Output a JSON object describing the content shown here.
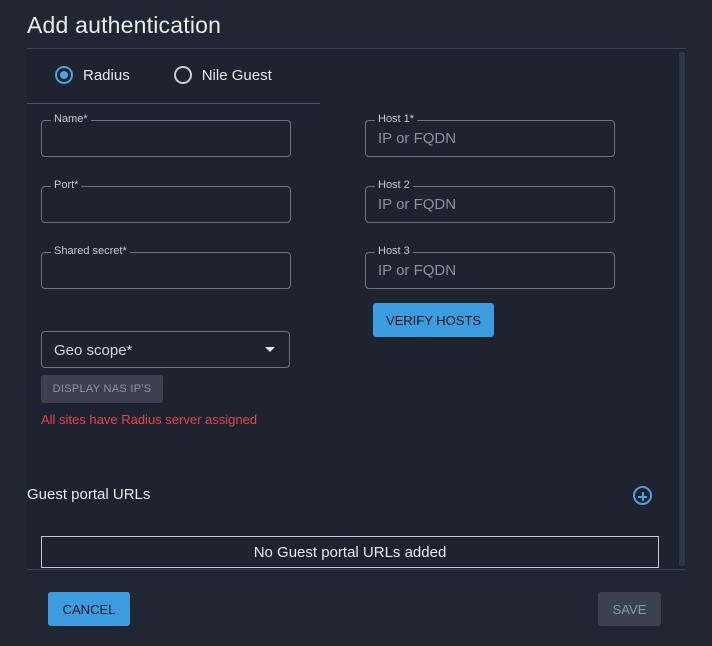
{
  "dialog": {
    "title": "Add authentication"
  },
  "tabs": [
    {
      "label": "Radius",
      "selected": true
    },
    {
      "label": "Nile Guest",
      "selected": false
    }
  ],
  "fields": {
    "name": {
      "label": "Name*",
      "value": "",
      "placeholder": ""
    },
    "port": {
      "label": "Port*",
      "value": "",
      "placeholder": ""
    },
    "shared_secret": {
      "label": "Shared secret*",
      "value": "",
      "placeholder": ""
    },
    "host1": {
      "label": "Host 1*",
      "value": "",
      "placeholder": "IP or FQDN"
    },
    "host2": {
      "label": "Host 2",
      "value": "",
      "placeholder": "IP or FQDN"
    },
    "host3": {
      "label": "Host 3",
      "value": "",
      "placeholder": "IP or FQDN"
    }
  },
  "geo_scope": {
    "label": "Geo scope*"
  },
  "buttons": {
    "verify_hosts": "VERIFY HOSTS",
    "display_nas": "DISPLAY NAS IP'S",
    "cancel": "CANCEL",
    "save": "SAVE"
  },
  "error_message": "All sites have Radius server assigned",
  "guest_portal": {
    "title": "Guest portal URLs",
    "empty_text": "No Guest portal URLs added"
  },
  "icons": {
    "add": "plus-circle-icon",
    "dropdown": "caret-down-icon"
  },
  "colors": {
    "accent": "#3b9ddd",
    "error": "#e3434b",
    "background": "#1f2733"
  }
}
